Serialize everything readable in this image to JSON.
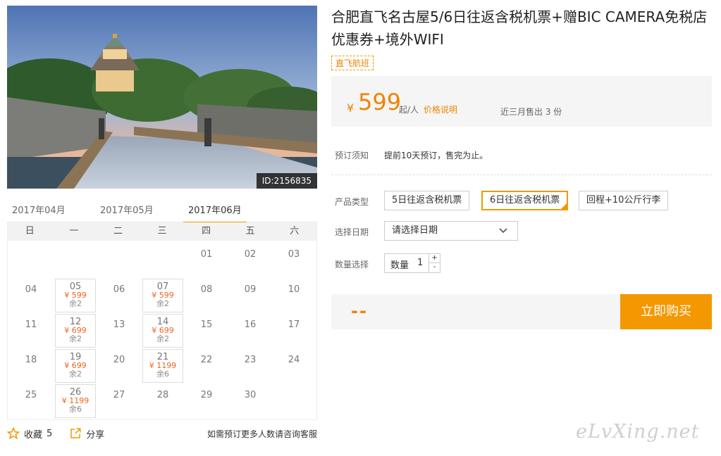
{
  "photo": {
    "id_label": "ID:2156835"
  },
  "months": [
    {
      "label": "2017年04月",
      "active": false
    },
    {
      "label": "2017年05月",
      "active": false
    },
    {
      "label": "2017年06月",
      "active": true
    }
  ],
  "weekdays": [
    "日",
    "一",
    "二",
    "三",
    "四",
    "五",
    "六"
  ],
  "calendar_days": [
    {
      "day": "01",
      "col": 4,
      "row": 0
    },
    {
      "day": "02",
      "col": 5,
      "row": 0
    },
    {
      "day": "03",
      "col": 6,
      "row": 0
    },
    {
      "day": "04",
      "col": 0,
      "row": 1
    },
    {
      "day": "05",
      "col": 1,
      "row": 1,
      "price": "¥ 599",
      "stock": "余2"
    },
    {
      "day": "06",
      "col": 2,
      "row": 1
    },
    {
      "day": "07",
      "col": 3,
      "row": 1,
      "price": "¥ 599",
      "stock": "余2"
    },
    {
      "day": "08",
      "col": 4,
      "row": 1
    },
    {
      "day": "09",
      "col": 5,
      "row": 1
    },
    {
      "day": "10",
      "col": 6,
      "row": 1
    },
    {
      "day": "11",
      "col": 0,
      "row": 2
    },
    {
      "day": "12",
      "col": 1,
      "row": 2,
      "price": "¥ 699",
      "stock": "余2"
    },
    {
      "day": "13",
      "col": 2,
      "row": 2
    },
    {
      "day": "14",
      "col": 3,
      "row": 2,
      "price": "¥ 699",
      "stock": "余2"
    },
    {
      "day": "15",
      "col": 4,
      "row": 2
    },
    {
      "day": "16",
      "col": 5,
      "row": 2
    },
    {
      "day": "17",
      "col": 6,
      "row": 2
    },
    {
      "day": "18",
      "col": 0,
      "row": 3
    },
    {
      "day": "19",
      "col": 1,
      "row": 3,
      "price": "¥ 699",
      "stock": "余2"
    },
    {
      "day": "20",
      "col": 2,
      "row": 3
    },
    {
      "day": "21",
      "col": 3,
      "row": 3,
      "price": "¥ 1199",
      "stock": "余6"
    },
    {
      "day": "22",
      "col": 4,
      "row": 3
    },
    {
      "day": "23",
      "col": 5,
      "row": 3
    },
    {
      "day": "24",
      "col": 6,
      "row": 3
    },
    {
      "day": "25",
      "col": 0,
      "row": 4
    },
    {
      "day": "26",
      "col": 1,
      "row": 4,
      "price": "¥ 1199",
      "stock": "余6"
    },
    {
      "day": "27",
      "col": 2,
      "row": 4
    },
    {
      "day": "28",
      "col": 3,
      "row": 4
    },
    {
      "day": "29",
      "col": 4,
      "row": 4
    },
    {
      "day": "30",
      "col": 5,
      "row": 4
    }
  ],
  "bottom": {
    "favorite_label": "收藏",
    "favorite_count": "5",
    "share_label": "分享",
    "note": "如需预订更多人数请咨询客服"
  },
  "product": {
    "title": "合肥直飞名古屋5/6日往返含税机票+赠BIC CAMERA免税店优惠券+境外WIFI",
    "tag": "直飞航班",
    "currency": "¥",
    "price": "599",
    "price_unit": "起/人",
    "price_note_link": "价格说明",
    "sold": "近三月售出 3 份"
  },
  "booking": {
    "notice_label": "预订须知",
    "notice_text": "提前10天预订，售完为止。",
    "type_label": "产品类型",
    "types": [
      "5日往返含税机票",
      "6日往返含税机票",
      "回程+10公斤行李"
    ],
    "date_label": "选择日期",
    "date_placeholder": "请选择日期",
    "qty_section_label": "数量选择",
    "qty_label": "数量",
    "qty_value": "1",
    "qty_plus": "+",
    "qty_minus": "-",
    "total": "--",
    "buy_label": "立即购买"
  },
  "watermark": "eLvXing.net",
  "colors": {
    "accent": "#f39800",
    "price": "#f08300"
  }
}
